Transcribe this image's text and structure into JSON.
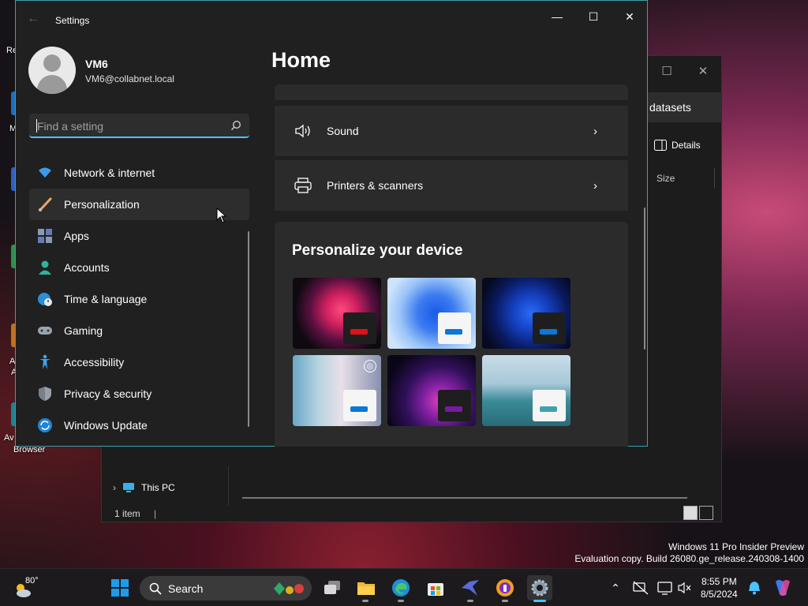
{
  "desktop": {
    "icon_labels": [
      "Re",
      "M",
      "A",
      "A",
      "Av",
      "Browser"
    ]
  },
  "explorer": {
    "tab_label": "datasets",
    "details_label": "Details",
    "size_column": "Size",
    "this_pc_label": "This PC",
    "status": "1 item"
  },
  "settings": {
    "window_title": "Settings",
    "profile": {
      "name": "VM6",
      "email": "VM6@collabnet.local"
    },
    "search": {
      "placeholder": "Find a setting"
    },
    "nav": [
      {
        "label": "Network & internet",
        "icon": "wifi-icon"
      },
      {
        "label": "Personalization",
        "icon": "brush-icon",
        "active": true
      },
      {
        "label": "Apps",
        "icon": "apps-icon"
      },
      {
        "label": "Accounts",
        "icon": "person-icon"
      },
      {
        "label": "Time & language",
        "icon": "globe-clock-icon"
      },
      {
        "label": "Gaming",
        "icon": "gamepad-icon"
      },
      {
        "label": "Accessibility",
        "icon": "accessibility-icon"
      },
      {
        "label": "Privacy & security",
        "icon": "shield-icon"
      },
      {
        "label": "Windows Update",
        "icon": "update-icon"
      }
    ],
    "main": {
      "title": "Home",
      "rows": [
        {
          "label": "Sound",
          "icon": "speaker-icon"
        },
        {
          "label": "Printers & scanners",
          "icon": "printer-icon"
        }
      ],
      "personalize": {
        "title": "Personalize your device"
      }
    }
  },
  "watermark": {
    "line1": "Windows 11 Pro Insider Preview",
    "line2": "Evaluation copy. Build 26080.ge_release.240308-1400"
  },
  "taskbar": {
    "weather_temp": "80°",
    "search_label": "Search",
    "time": "8:55 PM",
    "date": "8/5/2024"
  },
  "colors": {
    "accent": "#4cc2ff",
    "window_bg": "#202020",
    "card_bg": "#2b2b2b"
  }
}
